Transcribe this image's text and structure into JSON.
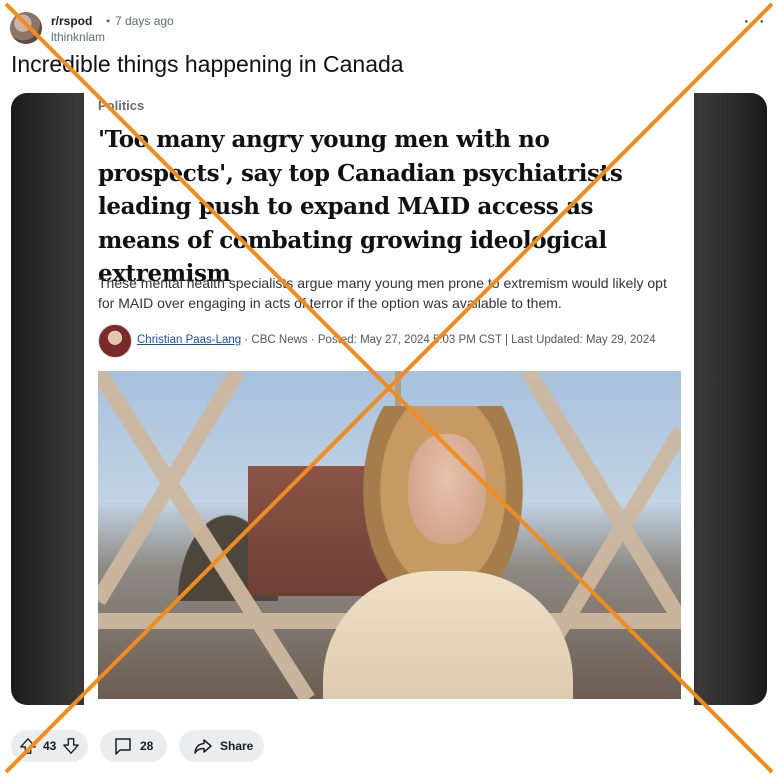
{
  "post": {
    "subreddit": "r/rspod",
    "separator": "•",
    "time": "7 days ago",
    "username": "lthinknlam",
    "title": "Incredible things happening in Canada"
  },
  "article": {
    "category": "Politics",
    "headline": "'Too many angry young men with no prospects', say top Canadian psychiatrists leading push to expand MAID access as means of combating growing ideological extremism",
    "deck": "These mental health specialists argue many young men prone to extremism would likely opt for MAID over engaging in acts of terror if the option was available to them.",
    "author": "Christian Paas-Lang",
    "byline_rest": " · CBC News · Posted: May 27, 2024 5:03 PM CST | Last Updated: May 29, 2024"
  },
  "actions": {
    "votes": "43",
    "comments": "28",
    "share_label": "Share"
  },
  "colors": {
    "overlay_x": "#f08c1e",
    "author_link": "#1b4f9c",
    "pill_bg": "#eaedef"
  },
  "icons": [
    "more-options-icon",
    "upvote-icon",
    "downvote-icon",
    "comment-icon",
    "share-icon"
  ]
}
